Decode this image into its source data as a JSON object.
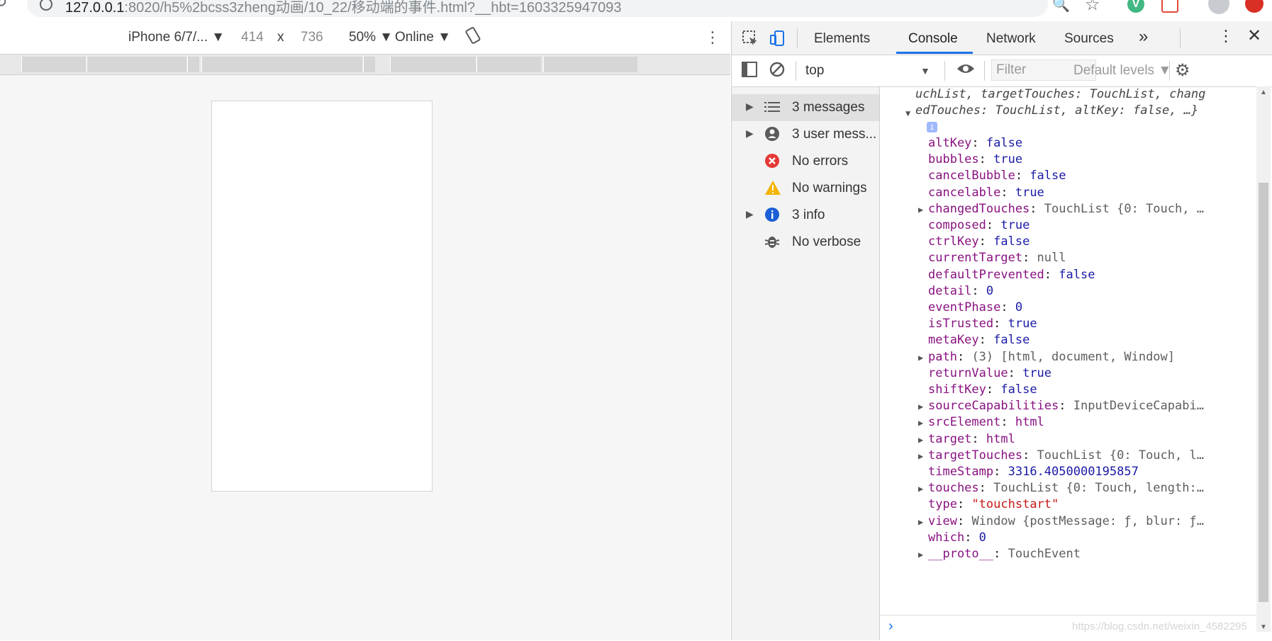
{
  "browser": {
    "url_host": "127.0.0.1",
    "url_rest": ":8020/h5%2bcss3zheng动画/10_22/移动端的事件.html?__hbt=1603325947093"
  },
  "device_toolbar": {
    "device": "iPhone 6/7/...",
    "width": "414",
    "times": "x",
    "height": "736",
    "zoom": "50%",
    "network": "Online"
  },
  "devtools": {
    "tabs": [
      "Elements",
      "Console",
      "Network",
      "Sources"
    ],
    "more_tabs": "»",
    "console_bar": {
      "context": "top",
      "filter_placeholder": "Filter",
      "levels": "Default levels"
    },
    "sidebar": [
      {
        "label": "3 messages",
        "icon": "list-icon"
      },
      {
        "label": "3 user mess...",
        "icon": "user-icon"
      },
      {
        "label": "No errors",
        "icon": "error-icon"
      },
      {
        "label": "No warnings",
        "icon": "warning-icon"
      },
      {
        "label": "3 info",
        "icon": "info-icon"
      },
      {
        "label": "No verbose",
        "icon": "bug-icon"
      }
    ],
    "output": {
      "header_line1": "uchList, targetTouches: TouchList, chang",
      "header_line2": "edTouches: TouchList, altKey: false, …}",
      "props": [
        {
          "key": "altKey",
          "val": "false",
          "type": "b"
        },
        {
          "key": "bubbles",
          "val": "true",
          "type": "b"
        },
        {
          "key": "cancelBubble",
          "val": "false",
          "type": "b"
        },
        {
          "key": "cancelable",
          "val": "true",
          "type": "b"
        },
        {
          "key": "changedTouches",
          "val": "TouchList {0: Touch, …",
          "type": "g",
          "expand": true
        },
        {
          "key": "composed",
          "val": "true",
          "type": "b"
        },
        {
          "key": "ctrlKey",
          "val": "false",
          "type": "b"
        },
        {
          "key": "currentTarget",
          "val": "null",
          "type": "g"
        },
        {
          "key": "defaultPrevented",
          "val": "false",
          "type": "b"
        },
        {
          "key": "detail",
          "val": "0",
          "type": "b"
        },
        {
          "key": "eventPhase",
          "val": "0",
          "type": "b"
        },
        {
          "key": "isTrusted",
          "val": "true",
          "type": "b"
        },
        {
          "key": "metaKey",
          "val": "false",
          "type": "b"
        },
        {
          "key": "path",
          "val": "(3) [html, document, Window]",
          "type": "g",
          "expand": true
        },
        {
          "key": "returnValue",
          "val": "true",
          "type": "b"
        },
        {
          "key": "shiftKey",
          "val": "false",
          "type": "b"
        },
        {
          "key": "sourceCapabilities",
          "val": "InputDeviceCapabi…",
          "type": "g",
          "expand": true
        },
        {
          "key": "srcElement",
          "val": "html",
          "type": "k",
          "expand": true
        },
        {
          "key": "target",
          "val": "html",
          "type": "k",
          "expand": true
        },
        {
          "key": "targetTouches",
          "val": "TouchList {0: Touch, l…",
          "type": "g",
          "expand": true
        },
        {
          "key": "timeStamp",
          "val": "3316.4050000195857",
          "type": "b"
        },
        {
          "key": "touches",
          "val": "TouchList {0: Touch, length:…",
          "type": "g",
          "expand": true
        },
        {
          "key": "type",
          "val": "\"touchstart\"",
          "type": "s"
        },
        {
          "key": "view",
          "val": "Window {postMessage: ƒ, blur: ƒ…",
          "type": "g",
          "expand": true
        },
        {
          "key": "which",
          "val": "0",
          "type": "b"
        },
        {
          "key": "__proto__",
          "val": "TouchEvent",
          "type": "g",
          "expand": true
        }
      ]
    }
  },
  "watermark": "https://blog.csdn.net/weixin_4582295"
}
